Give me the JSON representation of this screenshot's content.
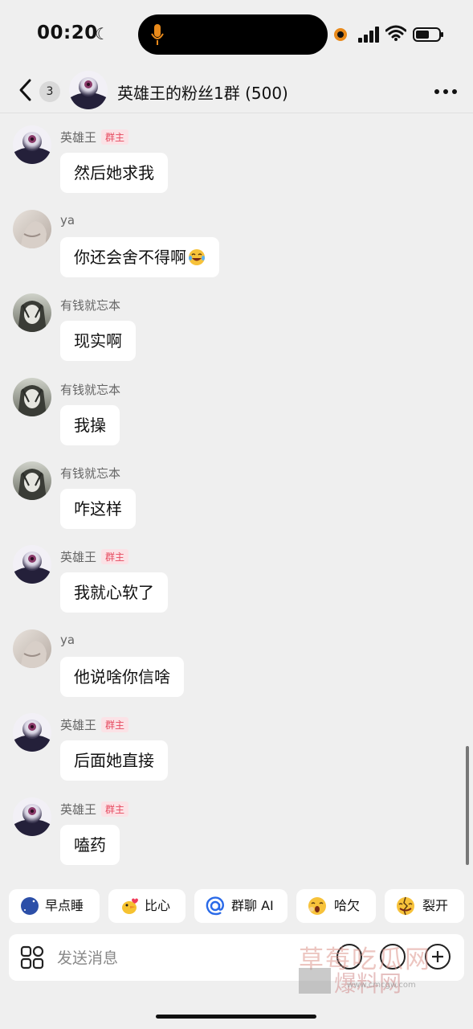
{
  "status": {
    "time": "00:20"
  },
  "header": {
    "unread_count": "3",
    "title": "英雄王的粉丝1群 (500)"
  },
  "messages": [
    {
      "sender": "英雄王",
      "badge": "群主",
      "text": "然后她求我",
      "avatar": "purple-eye"
    },
    {
      "sender": "ya",
      "badge": "",
      "text": "你还会舍不得啊",
      "avatar": "pale-girl",
      "emoji": "crying-laughing-emoji"
    },
    {
      "sender": "有钱就忘本",
      "badge": "",
      "text": "现实啊",
      "avatar": "anime-girl"
    },
    {
      "sender": "有钱就忘本",
      "badge": "",
      "text": "我操",
      "avatar": "anime-girl"
    },
    {
      "sender": "有钱就忘本",
      "badge": "",
      "text": "咋这样",
      "avatar": "anime-girl"
    },
    {
      "sender": "英雄王",
      "badge": "群主",
      "text": "我就心软了",
      "avatar": "purple-eye"
    },
    {
      "sender": "ya",
      "badge": "",
      "text": "他说啥你信啥",
      "avatar": "pale-girl"
    },
    {
      "sender": "英雄王",
      "badge": "群主",
      "text": "后面她直接",
      "avatar": "purple-eye"
    },
    {
      "sender": "英雄王",
      "badge": "群主",
      "text": "嗑药",
      "avatar": "purple-eye"
    }
  ],
  "quick_actions": [
    {
      "label": "早点睡",
      "icon": "moon-stars-icon"
    },
    {
      "label": "比心",
      "icon": "duck-heart-icon"
    },
    {
      "label": "群聊 AI",
      "icon": "at-icon"
    },
    {
      "label": "哈欠",
      "icon": "yawn-emoji-icon"
    },
    {
      "label": "裂开",
      "icon": "cracked-emoji-icon"
    }
  ],
  "input": {
    "placeholder": "发送消息"
  },
  "watermark": {
    "line1": "草莓吃瓜网",
    "line2": "爆料网",
    "url": "www.cmcgw.com"
  },
  "colors": {
    "background": "#efefef",
    "bubble": "#ffffff",
    "badge_text": "#e64a5f",
    "badge_bg": "#fbe2e6",
    "recording_dot": "#e98a1b"
  }
}
